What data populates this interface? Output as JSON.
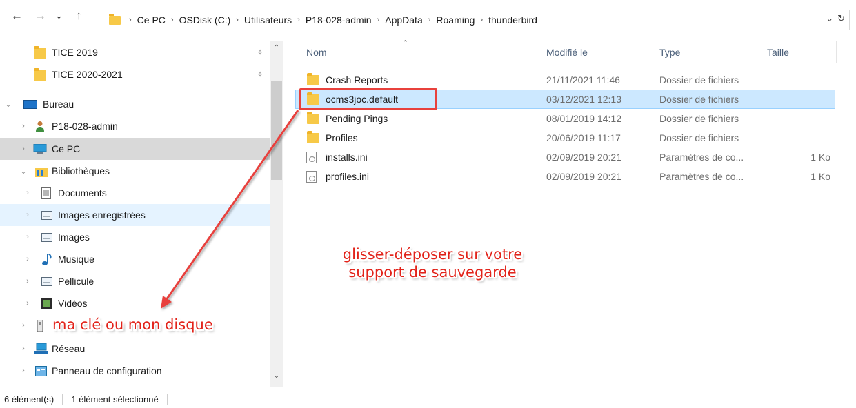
{
  "nav": {
    "back": "←",
    "forward": "→",
    "recent": "⌄",
    "up": "↑"
  },
  "address": {
    "crumbs": [
      "Ce PC",
      "OSDisk (C:)",
      "Utilisateurs",
      "P18-028-admin",
      "AppData",
      "Roaming",
      "thunderbird"
    ],
    "dropdown": "⌄",
    "refresh": "↻"
  },
  "sidebar": {
    "items": [
      {
        "label": "TICE 2019",
        "pinned": true,
        "icon": "folder-icon"
      },
      {
        "label": "TICE 2020-2021",
        "pinned": true,
        "icon": "folder-icon"
      },
      {
        "label": "Bureau",
        "icon": "desktop-icon"
      },
      {
        "label": "P18-028-admin",
        "icon": "user-icon"
      },
      {
        "label": "Ce PC",
        "icon": "computer-icon"
      },
      {
        "label": "Bibliothèques",
        "icon": "libraries-icon"
      },
      {
        "label": "Documents",
        "icon": "documents-icon"
      },
      {
        "label": "Images enregistrées",
        "icon": "saved-pictures-icon"
      },
      {
        "label": "Images",
        "icon": "pictures-icon"
      },
      {
        "label": "Musique",
        "icon": "music-icon"
      },
      {
        "label": "Pellicule",
        "icon": "camera-roll-icon"
      },
      {
        "label": "Vidéos",
        "icon": "videos-icon"
      },
      {
        "label": "",
        "icon": "usb-drive-icon"
      },
      {
        "label": "Réseau",
        "icon": "network-icon"
      },
      {
        "label": "Panneau de configuration",
        "icon": "control-panel-icon"
      }
    ]
  },
  "columns": {
    "name": "Nom",
    "modified": "Modifié le",
    "type": "Type",
    "size": "Taille"
  },
  "files": [
    {
      "name": "Crash Reports",
      "date": "21/11/2021 11:46",
      "type": "Dossier de fichiers",
      "size": "",
      "kind": "folder"
    },
    {
      "name": "ocms3joc.default",
      "date": "03/12/2021 12:13",
      "type": "Dossier de fichiers",
      "size": "",
      "kind": "folder",
      "selected": true
    },
    {
      "name": "Pending Pings",
      "date": "08/01/2019 14:12",
      "type": "Dossier de fichiers",
      "size": "",
      "kind": "folder"
    },
    {
      "name": "Profiles",
      "date": "20/06/2019 11:17",
      "type": "Dossier de fichiers",
      "size": "",
      "kind": "folder"
    },
    {
      "name": "installs.ini",
      "date": "02/09/2019 20:21",
      "type": "Paramètres de co...",
      "size": "1 Ko",
      "kind": "file"
    },
    {
      "name": "profiles.ini",
      "date": "02/09/2019 20:21",
      "type": "Paramètres de co...",
      "size": "1 Ko",
      "kind": "file"
    }
  ],
  "status": {
    "count": "6 élément(s)",
    "selection": "1 élément sélectionné"
  },
  "annotations": {
    "drag_line1": "glisser-déposer sur votre",
    "drag_line2": "support de sauvegarde",
    "target": "ma clé ou mon disque"
  },
  "colors": {
    "accent_red": "#e2231a",
    "selection_bg": "#cce8ff",
    "folder_yellow": "#f7c948"
  }
}
